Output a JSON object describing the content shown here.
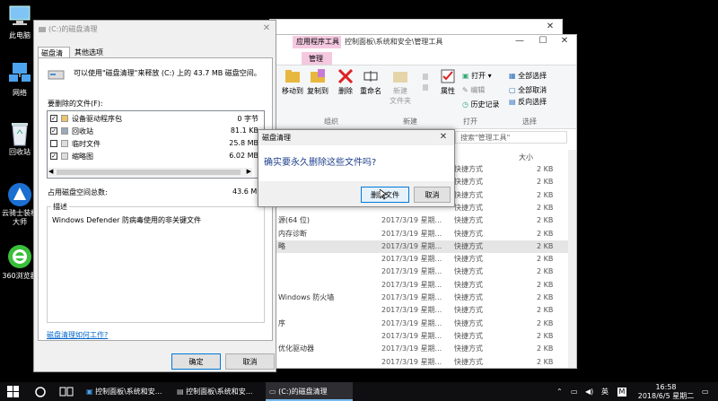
{
  "desktop": {
    "icons": [
      {
        "label": "此电脑"
      },
      {
        "label": "网络"
      },
      {
        "label": "回收站"
      },
      {
        "label": "云骑士装机大师"
      },
      {
        "label": "360浏览器"
      }
    ]
  },
  "explorer": {
    "tab_highlight": "应用程序工具",
    "tab_sub": "管理",
    "title": "控制面板\\系统和安全\\管理工具",
    "ribbon": {
      "move_to": "移动到",
      "copy_to": "复制到",
      "delete": "删除",
      "rename": "重命名",
      "new_folder_line1": "新建",
      "new_folder_line2": "文件夹",
      "properties": "属性",
      "open": "打开",
      "edit": "编辑",
      "history": "历史记录",
      "select_all": "全部选择",
      "select_none": "全部取消",
      "invert": "反向选择",
      "group_organize": "组织",
      "group_new": "新建",
      "group_open": "打开",
      "group_select": "选择"
    },
    "search_placeholder": "搜索\"管理工具\"",
    "col_size": "大小",
    "rows": [
      {
        "name": "",
        "date": "",
        "type": "快捷方式",
        "size": "2 KB"
      },
      {
        "name": "",
        "date": "",
        "type": "快捷方式",
        "size": "2 KB"
      },
      {
        "name": "",
        "date": "",
        "type": "快捷方式",
        "size": "2 KB"
      },
      {
        "name": "",
        "date": "",
        "type": "快捷方式",
        "size": "2 KB"
      },
      {
        "name": "源(64 位)",
        "date": "2017/3/19 星期...",
        "type": "快捷方式",
        "size": "2 KB"
      },
      {
        "name": "内存诊断",
        "date": "2017/3/19 星期...",
        "type": "快捷方式",
        "size": "2 KB"
      },
      {
        "name": "略",
        "date": "2017/3/19 星期...",
        "type": "快捷方式",
        "size": "2 KB"
      },
      {
        "name": "",
        "date": "2017/3/19 星期...",
        "type": "快捷方式",
        "size": "2 KB"
      },
      {
        "name": "",
        "date": "2017/3/19 星期...",
        "type": "快捷方式",
        "size": "2 KB"
      },
      {
        "name": "",
        "date": "2017/3/19 星期...",
        "type": "快捷方式",
        "size": "2 KB"
      },
      {
        "name": "Windows 防火墙",
        "date": "2017/3/19 星期...",
        "type": "快捷方式",
        "size": "2 KB"
      },
      {
        "name": "",
        "date": "2017/3/19 星期...",
        "type": "快捷方式",
        "size": "2 KB"
      },
      {
        "name": "序",
        "date": "2017/3/19 星期...",
        "type": "快捷方式",
        "size": "2 KB"
      },
      {
        "name": "",
        "date": "2017/3/19 星期...",
        "type": "快捷方式",
        "size": "2 KB"
      },
      {
        "name": "优化驱动器",
        "date": "2017/3/19 星期...",
        "type": "快捷方式",
        "size": "2 KB"
      },
      {
        "name": "",
        "date": "2017/3/19 星期...",
        "type": "快捷方式",
        "size": "2 KB"
      }
    ]
  },
  "cleanup": {
    "title": "(C:)的磁盘清理",
    "tabs": [
      "磁盘清理",
      "其他选项"
    ],
    "intro": "可以使用\"磁盘清理\"来释放 (C:) 上的 43.7 MB 磁盘空间。",
    "files_label": "要删除的文件(F):",
    "files": [
      {
        "name": "设备驱动程序包",
        "size": "0 字节",
        "checked": true
      },
      {
        "name": "回收站",
        "size": "81.1 KB",
        "checked": true
      },
      {
        "name": "临时文件",
        "size": "25.8 MB",
        "checked": false
      },
      {
        "name": "缩略图",
        "size": "6.02 MB",
        "checked": true
      }
    ],
    "space_label": "占用磁盘空间总数:",
    "space_value": "43.6 M",
    "desc_label": "描述",
    "desc_text": "Windows Defender 防病毒使用的非关键文件",
    "help_link": "磁盘清理如何工作?",
    "ok": "确定",
    "cancel": "取消"
  },
  "confirm": {
    "title": "磁盘清理",
    "question": "确实要永久删除这些文件吗?",
    "delete": "删除文件",
    "cancel": "取消"
  },
  "taskbar": {
    "items": [
      "控制面板\\系统和安...",
      "控制面板\\系统和安...",
      "(C:)的磁盘清理"
    ],
    "ime": "英",
    "ime2": "M",
    "time": "16:58",
    "date": "2018/6/5 星期二"
  },
  "colors": {
    "accent": "#0078d7",
    "link": "#0066cc",
    "tab_pink": "#f4c9e0"
  }
}
